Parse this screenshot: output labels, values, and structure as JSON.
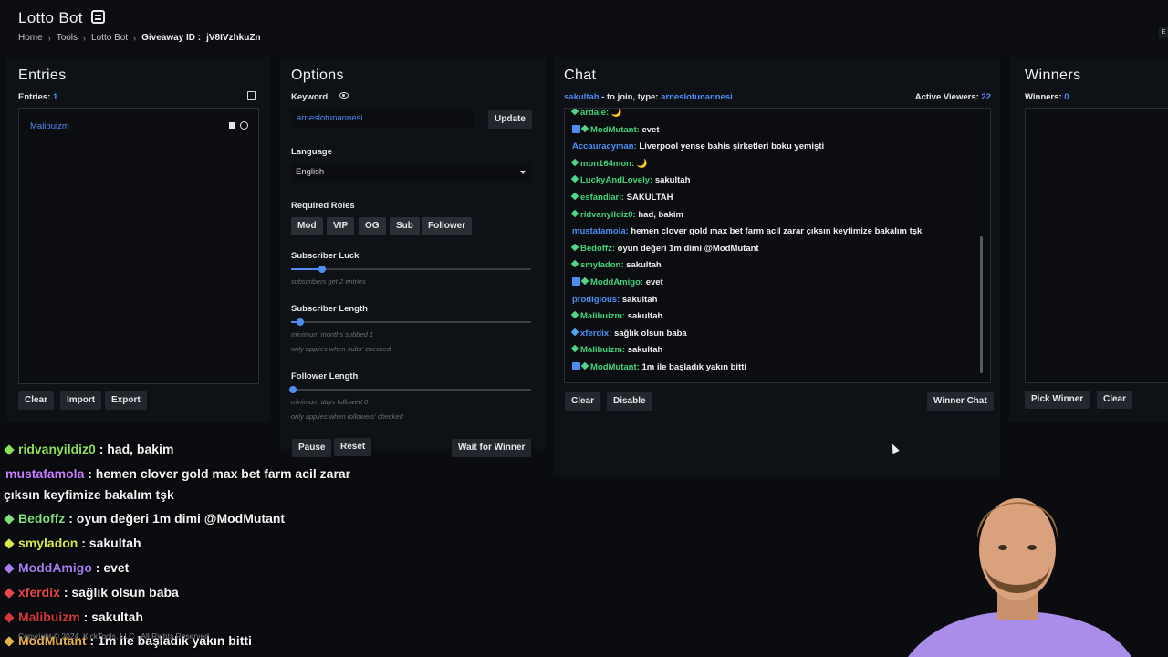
{
  "header": {
    "title": "Lotto Bot",
    "breadcrumb": [
      "Home",
      "Tools",
      "Lotto Bot"
    ],
    "giveaway_label": "Giveaway ID :",
    "giveaway_id": "jV8IVzhkuZn",
    "corner": "E"
  },
  "entries": {
    "title": "Entries",
    "count_label": "Entries:",
    "count": "1",
    "items": [
      "Malibuizm"
    ],
    "buttons": {
      "clear": "Clear",
      "import": "Import",
      "export": "Export"
    }
  },
  "options": {
    "title": "Options",
    "keyword_label": "Keyword",
    "keyword_value": "arneslotunannesi",
    "update": "Update",
    "language_label": "Language",
    "language_value": "English",
    "roles_label": "Required Roles",
    "roles": [
      "Mod",
      "VIP",
      "OG",
      "Sub",
      "Follower"
    ],
    "sub_luck_label": "Subscriber Luck",
    "sub_luck_hint": "subscribers get 2 entries",
    "sub_luck_level": 0.12,
    "sub_length_label": "Subscriber Length",
    "sub_length_hint1": "minimum months subbed 1",
    "sub_length_hint2": "only applies when subs' checked",
    "sub_length_level": 0.03,
    "follower_label": "Follower Length",
    "follower_hint1": "minimum days followed 0",
    "follower_hint2": "only applies when followers' checked",
    "follower_level": 0.0,
    "buttons": {
      "pause": "Pause",
      "reset": "Reset",
      "wait": "Wait for Winner"
    }
  },
  "chat": {
    "title": "Chat",
    "channel": "sakultah",
    "join_text": "- to join, type:",
    "keyword": "arneslotunannesi",
    "viewers_label": "Active Viewers:",
    "viewers": "22",
    "messages": [
      {
        "user": "ardale:",
        "text": "🌙",
        "badge": "gem"
      },
      {
        "user": "ModMutant:",
        "text": "evet",
        "badge": "mod-gem"
      },
      {
        "user": "Accauracyman:",
        "text": "Liverpool yense bahis şirketleri boku yemişti",
        "badge": ""
      },
      {
        "user": "mon164mon:",
        "text": "🌙",
        "badge": "gem"
      },
      {
        "user": "LuckyAndLovely:",
        "text": "sakultah",
        "badge": "gem"
      },
      {
        "user": "esfandiari:",
        "text": "SAKULTAH",
        "badge": "gem"
      },
      {
        "user": "ridvanyildiz0:",
        "text": "had, bakim",
        "badge": "gem"
      },
      {
        "user": "mustafamola:",
        "text": "hemen clover gold max bet farm acil zarar çıksın keyfimize bakalım tşk",
        "badge": ""
      },
      {
        "user": "Bedoffz:",
        "text": "oyun değeri 1m dimi @ModMutant",
        "badge": "gem"
      },
      {
        "user": "smyladon:",
        "text": "sakultah",
        "badge": "gem"
      },
      {
        "user": "ModdAmigo:",
        "text": "evet",
        "badge": "mod-gem"
      },
      {
        "user": "prodigious:",
        "text": "sakultah",
        "badge": ""
      },
      {
        "user": "Malibuizm:",
        "text": "sakultah",
        "badge": "gem"
      },
      {
        "user": "xferdix:",
        "text": "sağlık olsun baba",
        "badge": "cube"
      },
      {
        "user": "Malibuizm:",
        "text": "sakultah",
        "badge": "gem"
      },
      {
        "user": "ModMutant:",
        "text": "1m ile başladık yakın bitti",
        "badge": "mod-gem"
      }
    ],
    "buttons": {
      "clear": "Clear",
      "disable": "Disable",
      "winner_chat": "Winner Chat"
    }
  },
  "winners": {
    "title": "Winners",
    "count_label": "Winners:",
    "count": "0",
    "buttons": {
      "pick": "Pick Winner",
      "clear": "Clear"
    }
  },
  "overlay": {
    "lines": [
      {
        "user": "ridvanyildiz0",
        "text": ": had, bakim",
        "color": "#8de05a"
      },
      {
        "user": "mustafamola",
        "text": ": hemen clover gold max bet farm acil zarar",
        "color": "#c77dff"
      },
      {
        "user": "",
        "text": "çıksın keyfimize bakalım tşk",
        "color": "#ffffff"
      },
      {
        "user": "Bedoffz",
        "text": ": oyun değeri 1m dimi @ModMutant",
        "color": "#7de07d"
      },
      {
        "user": "smyladon",
        "text": ": sakultah",
        "color": "#d8e84a"
      },
      {
        "user": "ModdAmigo",
        "text": ": evet",
        "color": "#a57cf0"
      },
      {
        "user": "xferdix",
        "text": ": sağlık olsun baba",
        "color": "#e84a4a"
      },
      {
        "user": "Malibuizm",
        "text": ": sakultah",
        "color": "#d03a3a"
      },
      {
        "user": "ModMutant",
        "text": ": 1m ile başladık yakın bitti",
        "color": "#e8b24a"
      }
    ],
    "copyright": "Copyright © 2024, KickTools, LLC - All Rights Reserved"
  }
}
